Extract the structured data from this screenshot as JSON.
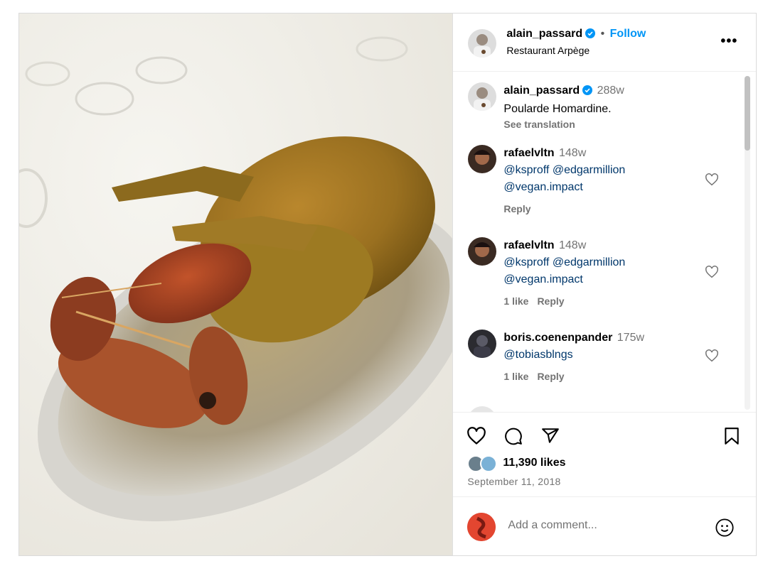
{
  "post": {
    "author": "alain_passard",
    "follow_label": "Follow",
    "separator": "•",
    "location": "Restaurant Arpège",
    "more_label": "•••",
    "caption": {
      "user": "alain_passard",
      "time": "288w",
      "text": "Poularde Homardine.",
      "see_translation": "See translation"
    },
    "comments": [
      {
        "user": "rafaelvltn",
        "time": "148w",
        "line1": "@ksproff @edgarmillion",
        "line2": "@vegan.impact",
        "likes": "",
        "reply": "Reply"
      },
      {
        "user": "rafaelvltn",
        "time": "148w",
        "line1": "@ksproff @edgarmillion",
        "line2": "@vegan.impact",
        "likes": "1 like",
        "reply": "Reply"
      },
      {
        "user": "boris.coenenpander",
        "time": "175w",
        "line1": "@tobiasblngs",
        "line2": "",
        "likes": "1 like",
        "reply": "Reply"
      }
    ],
    "likes": "11,390 likes",
    "date": "September 11, 2018",
    "add_comment_placeholder": "Add a comment..."
  },
  "colors": {
    "accent": "#0095f6",
    "mention": "#00376b",
    "muted": "#737373",
    "verified": "#0095f6"
  },
  "icons": [
    "verified-icon",
    "more-icon",
    "heart-icon",
    "comment-icon",
    "share-icon",
    "save-icon",
    "emoji-icon"
  ]
}
